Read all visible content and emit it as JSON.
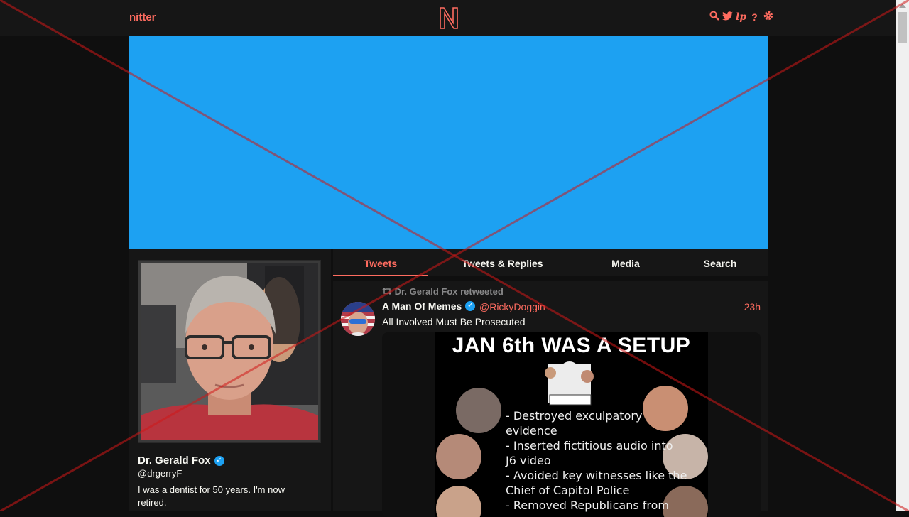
{
  "navbar": {
    "brand": "nitter",
    "logo_letter": "N",
    "icons": [
      "search-icon",
      "twitter-bird-icon",
      "lp-icon",
      "help-icon",
      "gear-icon"
    ],
    "icon_glyphs": {
      "lp": "lp",
      "help": "?"
    }
  },
  "colors": {
    "accent": "#ff6c60",
    "background": "#0f0f0f",
    "panel": "#161616",
    "banner": "#1da1f2",
    "verified": "#1da1f2"
  },
  "profile": {
    "fullname": "Dr. Gerald Fox",
    "username": "@drgerryF",
    "bio": "I was a dentist for 50 years. I'm now retired.",
    "verified": true
  },
  "tabs": [
    {
      "label": "Tweets",
      "active": true
    },
    {
      "label": "Tweets & Replies",
      "active": false
    },
    {
      "label": "Media",
      "active": false
    },
    {
      "label": "Search",
      "active": false
    }
  ],
  "tweet": {
    "retweet_header": "Dr. Gerald Fox retweeted",
    "author_name": "A Man Of Memes",
    "author_handle": "@RickyDoggin",
    "date": "23h",
    "text": "All Involved Must Be Prosecuted",
    "image": {
      "title": "JAN 6th WAS A SETUP",
      "lines": [
        "- Destroyed exculpatory",
        "evidence",
        "- Inserted fictitious audio into",
        "J6 video",
        "- Avoided key witnesses like the",
        "Chief of Capitol Police",
        "- Removed Republicans from"
      ]
    }
  }
}
